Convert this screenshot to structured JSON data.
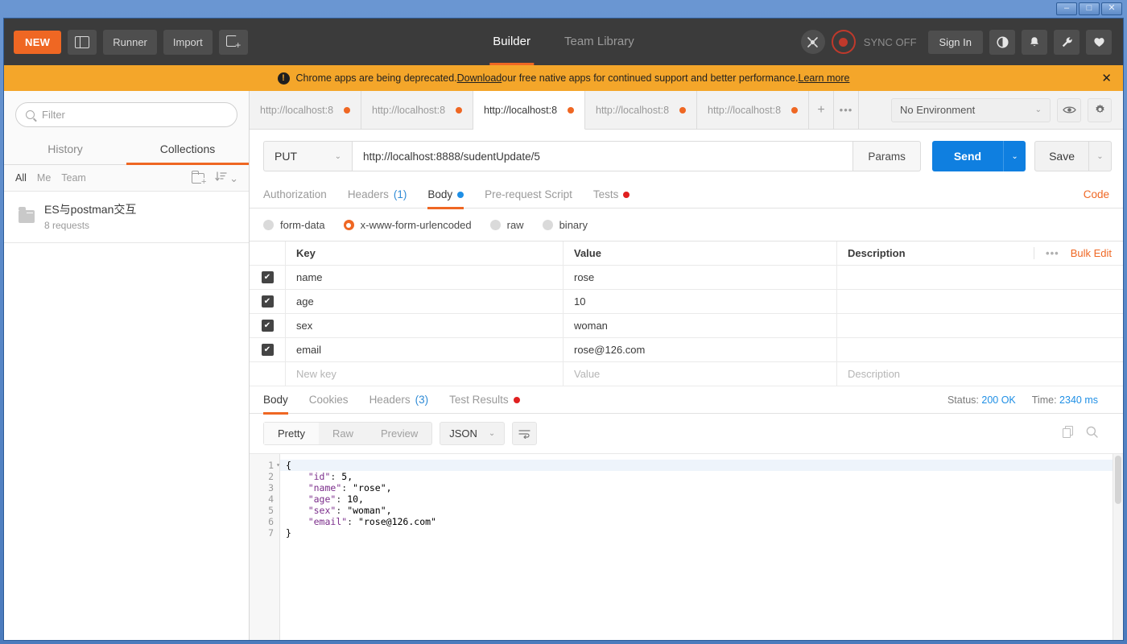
{
  "window": {
    "minimize_label": "–",
    "maximize_label": "□",
    "close_label": "✕"
  },
  "header": {
    "new_label": "NEW",
    "sidebar_toggle_name": "split-pane-icon",
    "runner_label": "Runner",
    "import_label": "Import",
    "new_tab_icon": "new-window-icon",
    "tabs": [
      {
        "label": "Builder",
        "active": true
      },
      {
        "label": "Team Library",
        "active": false
      }
    ],
    "interceptor_icon": "satellite-icon",
    "sync_status": "SYNC OFF",
    "sign_in_label": "Sign In",
    "icons": [
      {
        "name": "globe-icon",
        "glyph": "◔"
      },
      {
        "name": "bell-icon",
        "glyph": "🔔"
      },
      {
        "name": "wrench-icon",
        "glyph": "🔧"
      },
      {
        "name": "heart-icon",
        "glyph": "♥"
      }
    ]
  },
  "banner": {
    "icon": "alert-icon",
    "text_before": "Chrome apps are being deprecated. ",
    "link_download": "Download",
    "text_middle": " our free native apps for continued support and better performance. ",
    "link_learn": "Learn more",
    "close_label": "✕",
    "background": "#f4a62a"
  },
  "sidebar": {
    "filter_placeholder": "Filter",
    "search_icon": "search-icon",
    "tabs": [
      {
        "label": "History",
        "active": false
      },
      {
        "label": "Collections",
        "active": true
      }
    ],
    "scopes": [
      {
        "label": "All",
        "active": true
      },
      {
        "label": "Me",
        "active": false
      },
      {
        "label": "Team",
        "active": false
      }
    ],
    "new_folder_icon": "new-folder-icon",
    "sort_icon": "sort-icon",
    "sort_caret": "⌄",
    "collections": [
      {
        "name": "ES与postman交互",
        "requests": "8 requests",
        "icon": "folder-icon"
      }
    ]
  },
  "request_tabs": {
    "items": [
      {
        "label": "http://localhost:8",
        "active": false,
        "unsaved": true
      },
      {
        "label": "http://localhost:8",
        "active": false,
        "unsaved": true
      },
      {
        "label": "http://localhost:8",
        "active": true,
        "unsaved": true
      },
      {
        "label": "http://localhost:8",
        "active": false,
        "unsaved": true
      },
      {
        "label": "http://localhost:8",
        "active": false,
        "unsaved": true
      }
    ],
    "add_label": "+",
    "more_label": "•••"
  },
  "environment": {
    "selected": "No Environment",
    "caret": "⌄",
    "eye_icon": "eye-icon",
    "gear_icon": "gear-icon"
  },
  "url_bar": {
    "method": "PUT",
    "method_caret": "⌄",
    "url": "http://localhost:8888/sudentUpdate/5",
    "params_label": "Params",
    "send_label": "Send",
    "send_caret": "⌄",
    "save_label": "Save",
    "save_caret": "⌄"
  },
  "request_section": {
    "tabs": [
      {
        "label": "Authorization",
        "active": false,
        "count": "",
        "dot": ""
      },
      {
        "label": "Headers",
        "active": false,
        "count": "(1)",
        "dot": ""
      },
      {
        "label": "Body",
        "active": true,
        "count": "",
        "dot": "blue"
      },
      {
        "label": "Pre-request Script",
        "active": false,
        "count": "",
        "dot": ""
      },
      {
        "label": "Tests",
        "active": false,
        "count": "",
        "dot": "red"
      }
    ],
    "code_label": "Code",
    "body_types": [
      {
        "label": "form-data",
        "selected": false
      },
      {
        "label": "x-www-form-urlencoded",
        "selected": true
      },
      {
        "label": "raw",
        "selected": false
      },
      {
        "label": "binary",
        "selected": false
      }
    ],
    "table": {
      "headers": {
        "key": "Key",
        "value": "Value",
        "description": "Description"
      },
      "dots_label": "•••",
      "bulk_edit_label": "Bulk Edit",
      "check_glyph": "✔",
      "rows": [
        {
          "checked": true,
          "key": "name",
          "value": "rose",
          "description": ""
        },
        {
          "checked": true,
          "key": "age",
          "value": "10",
          "description": ""
        },
        {
          "checked": true,
          "key": "sex",
          "value": "woman",
          "description": ""
        },
        {
          "checked": true,
          "key": "email",
          "value": "rose@126.com",
          "description": ""
        }
      ],
      "placeholder_row": {
        "key": "New key",
        "value": "Value",
        "description": "Description"
      }
    }
  },
  "response_section": {
    "tabs": [
      {
        "label": "Body",
        "active": true,
        "count": "",
        "dot": ""
      },
      {
        "label": "Cookies",
        "active": false,
        "count": "",
        "dot": ""
      },
      {
        "label": "Headers",
        "active": false,
        "count": "(3)",
        "dot": ""
      },
      {
        "label": "Test Results",
        "active": false,
        "count": "",
        "dot": "red"
      }
    ],
    "status_label": "Status:",
    "status_value": "200 OK",
    "time_label": "Time:",
    "time_value": "2340 ms",
    "view_modes": [
      {
        "label": "Pretty",
        "active": true
      },
      {
        "label": "Raw",
        "active": false
      },
      {
        "label": "Preview",
        "active": false
      }
    ],
    "format": "JSON",
    "format_caret": "⌄",
    "wrap_icon": "word-wrap-icon",
    "copy_icon": "copy-icon",
    "search_icon": "search-icon",
    "body": {
      "language": "json",
      "line_numbers": [
        "1",
        "2",
        "3",
        "4",
        "5",
        "6",
        "7"
      ],
      "lines": [
        "{",
        "    \"id\": 5,",
        "    \"name\": \"rose\",",
        "    \"age\": 10,",
        "    \"sex\": \"woman\",",
        "    \"email\": \"rose@126.com\"",
        "}"
      ]
    }
  },
  "colors": {
    "accent_orange": "#ef6723",
    "send_blue": "#0f7fe0",
    "header_dark": "#3b3b3b",
    "banner_orange": "#f4a62a",
    "status_blue": "#1f8fe5",
    "window_border": "#2f5d99"
  }
}
